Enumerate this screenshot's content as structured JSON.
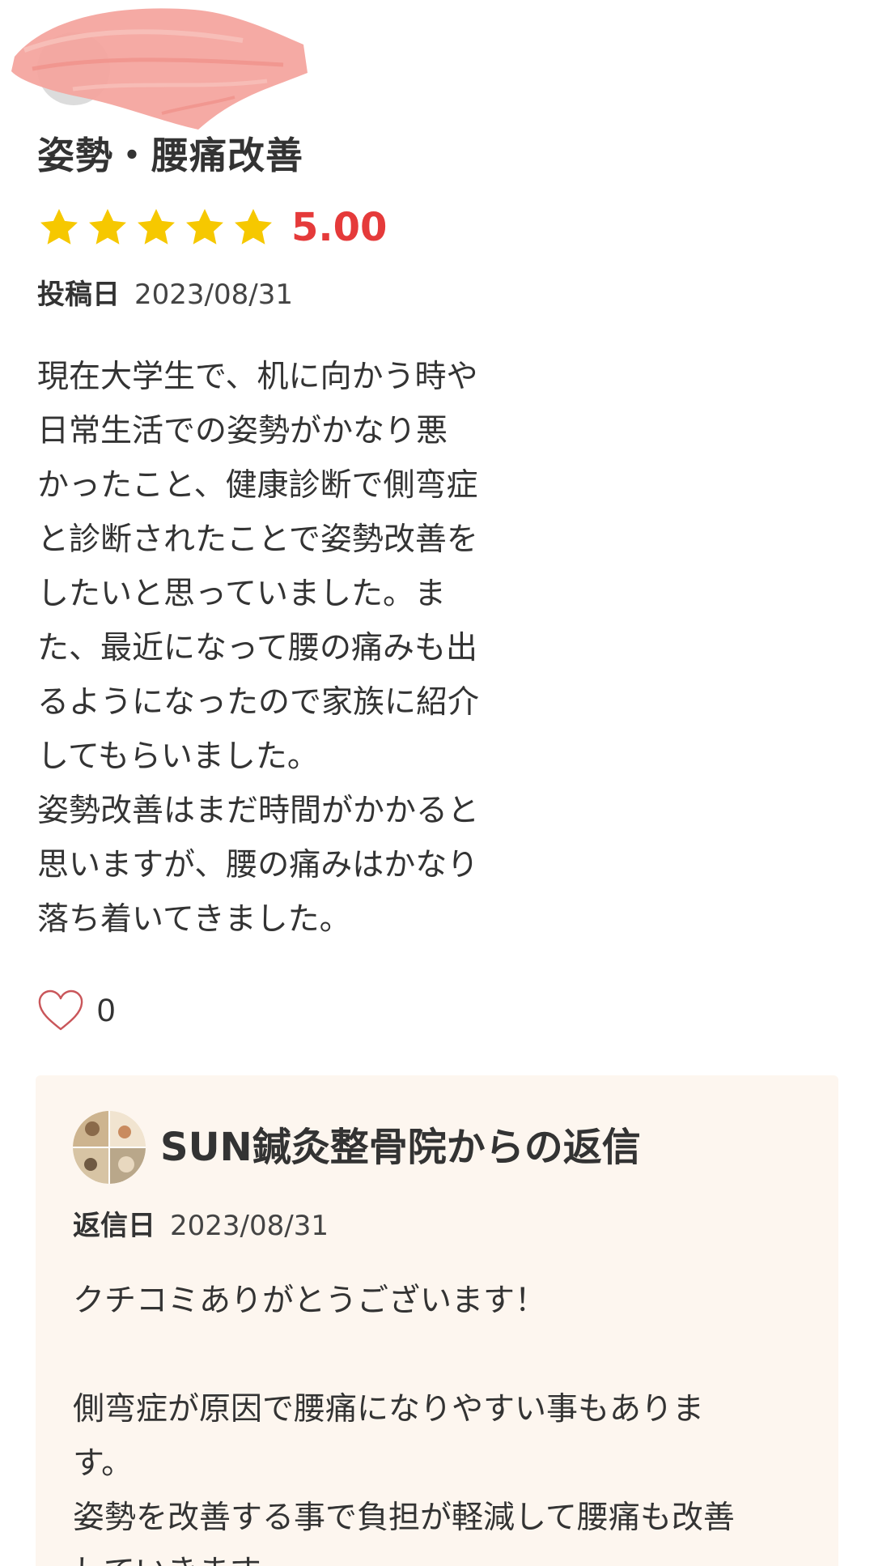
{
  "review": {
    "title": "姿勢・腰痛改善",
    "rating": "5.00",
    "star_count": 5,
    "post_date_label": "投稿日",
    "post_date": "2023/08/31",
    "body": "現在大学生で、机に向かう時や\n日常生活での姿勢がかなり悪\nかったこと、健康診断で側弯症\nと診断されたことで姿勢改善を\nしたいと思っていました。ま\nた、最近になって腰の痛みも出\nるようになったので家族に紹介\nしてもらいました。\n姿勢改善はまだ時間がかかると\n思いますが、腰の痛みはかなり\n落ち着いてきました。",
    "like_count": "0"
  },
  "reply": {
    "title": "SUN鍼灸整骨院からの返信",
    "date_label": "返信日",
    "date": "2023/08/31",
    "body": "クチコミありがとうございます！\n\n側弯症が原因で腰痛になりやすい事もありま\nす。\n姿勢を改善する事で負担が軽減して腰痛も改善\nしていきます。"
  },
  "colors": {
    "star": "#f6c800",
    "rating_value": "#e53a3a",
    "reply_background": "#fdf6ef",
    "redaction": "#f4a39c",
    "heart_outline": "#c9565a"
  },
  "icons": {
    "star": "star-icon",
    "like": "heart-outline-icon"
  }
}
